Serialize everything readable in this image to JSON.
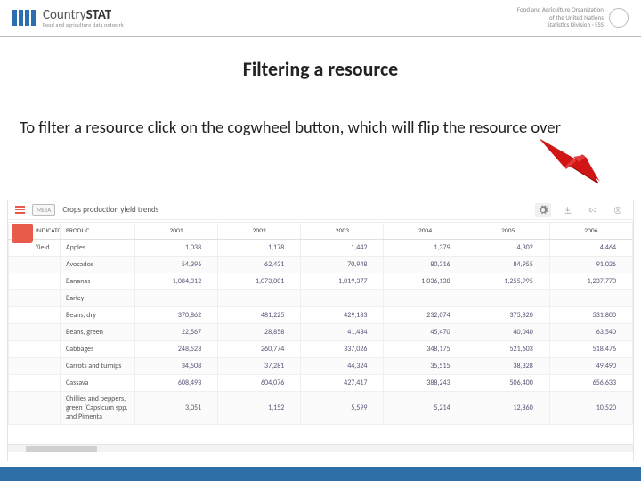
{
  "header": {
    "brand_main": "Country",
    "brand_bold": "STAT",
    "brand_sub": "Food and agriculture data network",
    "fao_line1": "Food and Agriculture Organization",
    "fao_line2": "of the United Nations",
    "fao_line3": "Statistics Division · ESS"
  },
  "title": "Filtering a resource",
  "instruction": "To filter a resource click on the cogwheel button, which will flip the resource over",
  "screenshot": {
    "meta_label": "META",
    "panel_title": "Crops production yield trends",
    "red_tag": "",
    "columns": [
      "INDICATOR",
      "PRODUC",
      "2001",
      "2002",
      "2003",
      "2004",
      "2005",
      "2006"
    ],
    "indicator": "Yield",
    "rows": [
      {
        "p": "Apples",
        "v": [
          "1,038",
          "1,178",
          "1,442",
          "1,379",
          "4,302",
          "4,464"
        ]
      },
      {
        "p": "Avocados",
        "v": [
          "54,396",
          "62,431",
          "70,948",
          "80,316",
          "84,955",
          "91,026"
        ]
      },
      {
        "p": "Bananas",
        "v": [
          "1,084,312",
          "1,073,001",
          "1,019,377",
          "1,036,138",
          "1,255,995",
          "1,237,770"
        ]
      },
      {
        "p": "Barley",
        "v": [
          "",
          "",
          "",
          "",
          "",
          ""
        ]
      },
      {
        "p": "Beans, dry",
        "v": [
          "370,862",
          "481,225",
          "429,183",
          "232,074",
          "375,820",
          "531,800"
        ]
      },
      {
        "p": "Beans, green",
        "v": [
          "22,567",
          "28,858",
          "41,434",
          "45,470",
          "40,040",
          "63,540"
        ]
      },
      {
        "p": "Cabbages",
        "v": [
          "248,523",
          "260,774",
          "337,026",
          "348,175",
          "521,603",
          "518,476"
        ]
      },
      {
        "p": "Carrots and turnips",
        "v": [
          "34,508",
          "37,281",
          "44,324",
          "35,515",
          "38,328",
          "49,490"
        ]
      },
      {
        "p": "Cassava",
        "v": [
          "608,493",
          "604,076",
          "427,417",
          "388,243",
          "506,400",
          "656,633"
        ]
      },
      {
        "p": "Chillies and peppers, green (Capsicum spp. and Pimenta",
        "v": [
          "3,051",
          "1,152",
          "5,599",
          "5,214",
          "12,860",
          "10,520"
        ]
      }
    ]
  }
}
